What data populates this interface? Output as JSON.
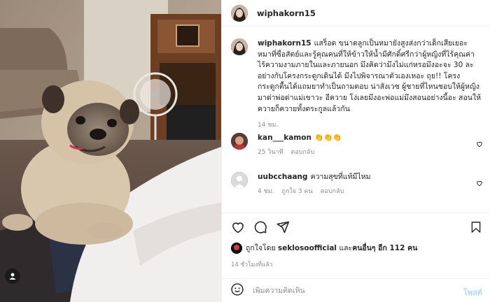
{
  "post": {
    "username": "wiphakorn15",
    "caption": "แสร็อด ขนาดลูกเป็นหมายังสูงส่งกว่าเด็กเสียเยอะ หมาที่ซื่อสัตย์และรู้คุณคนที่ให้ข้าวให้น้ำมีศักดิ์ศรีกว่าผู้หญิงที่ไร้คุณค่าไร้ความงามภายในและภายนอก มึงคิดว่ามึงไม่แก่หรอมึงอะจะ 30 ละ อย่างกับโครงกระดูกเดินได้ มึงไปพิจารณาตัวเองเหอะ ถุย!! โครงกระดูกตื้นได้แถมยาทำเป็นถามตอบ น่าสังเวช ผู้ชายที่ไหนชอบให้ผู้หญิงมาด่าพ่อด่าแม่เขาวะ อีควาย โง่เลยมึงอะพ่อแม่มึงสอนอย่างนี้อะ สอนให้ควายก็ควายทั้งตระกูลแล้วกัน",
    "time": "14 ชม."
  },
  "comments": [
    {
      "username": "kan___kamon",
      "text": "👏👏👏",
      "time": "25 วินาที",
      "likes": "",
      "reply": "ตอบกลับ"
    },
    {
      "username": "uubcchaang",
      "text": "ความสุขที่แท้มีไหม",
      "time": "4 ชม.",
      "likes": "ถูกใจ 3 คน",
      "reply": "ตอบกลับ"
    }
  ],
  "likes": {
    "prefix": "ถูกใจโดย",
    "first_user": "seklosoofficial",
    "connector": "และ",
    "others": "คนอื่นๆ อีก 112 คน"
  },
  "posted_ago": "14 ชั่วโมงที่แล้ว",
  "comment_box": {
    "placeholder": "เพิ่มความคิดเห็น",
    "post_label": "โพสต์"
  },
  "colors": {
    "link_disabled": "#b3dbff",
    "text": "#262626",
    "secondary": "#8e8e8e",
    "border": "#efefef"
  },
  "icons": [
    "heart-icon",
    "comment-icon",
    "share-icon",
    "bookmark-icon",
    "emoji-icon",
    "user-tag-icon",
    "more-icon"
  ]
}
